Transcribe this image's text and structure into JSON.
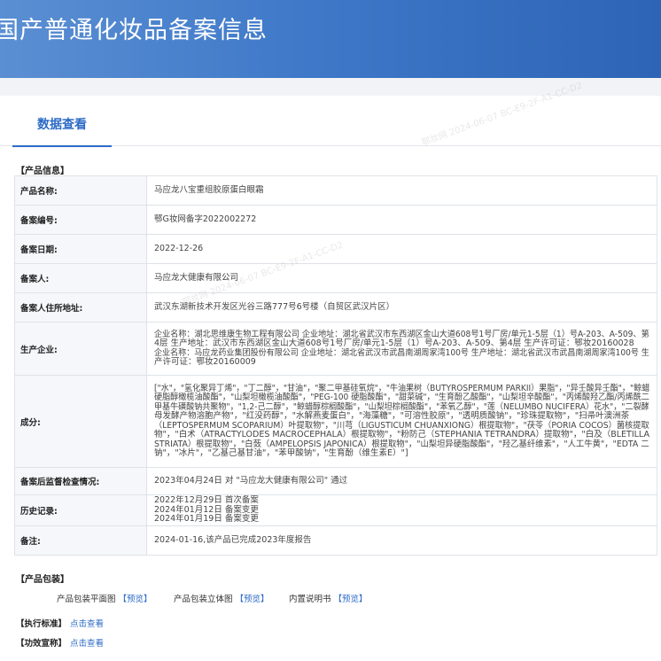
{
  "banner": {
    "title": "国产普通化妆品备案信息"
  },
  "tabs": {
    "active": "数据查看"
  },
  "product_section": {
    "title": "【产品信息】",
    "rows": [
      {
        "label": "产品名称:",
        "value": [
          "马应龙八宝重组胶原蛋白眼霜"
        ]
      },
      {
        "label": "备案编号:",
        "value": [
          "鄂G妆网备字2022002272"
        ]
      },
      {
        "label": "备案日期:",
        "value": [
          "2022-12-26"
        ]
      },
      {
        "label": "备案人:",
        "value": [
          "马应龙大健康有限公司"
        ]
      },
      {
        "label": "备案人住所地址:",
        "value": [
          "武汉东湖新技术开发区光谷三路777号6号楼（自贸区武汉片区）"
        ]
      },
      {
        "label": "生产企业:",
        "value": [
          "企业名称：湖北思维康生物工程有限公司 企业地址：湖北省武汉市东西湖区金山大道608号1号厂房/单元1-5层（1）号A-203、A-509、第",
          "4层 生产地址：武汉市东西湖区金山大道608号1号厂房/单元1-5层（1）号A-203、A-509、第4层 生产许可证：鄂妆20160028",
          "企业名称：马应龙药业集团股份有限公司 企业地址：湖北省武汉市武昌南湖周家湾100号 生产地址：湖北省武汉市武昌南湖周家湾100号 生",
          "产许可证：鄂妆20160009"
        ]
      },
      {
        "label": "成分:",
        "value": [
          "[\"水\"，\"氢化聚异丁烯\"，\"丁二醇\"，\"甘油\"，\"聚二甲基硅氧烷\"，\"牛油果树（BUTYROSPERMUM PARKII）果脂\"，\"异壬酸异壬酯\"，\"鲸蜡",
          "硬脂醇橄榄油酸酯\"，\"山梨坦橄榄油酸酯\"，\"PEG-100 硬脂酸酯\"，\"甜菜碱\"，\"生育酚乙酸酯\"，\"山梨坦辛酸酯\"，\"丙烯酸羟乙酯/丙烯酰二",
          "甲基牛磺酸钠共聚物\"，\"1,2-己二醇\"，\"鲸蜡醇棕榈酸酯\"，\"山梨坦棕榈酸酯\"，\"苯氧乙醇\"，\"莲（NELUMBO NUCIFERA）花水\"，\"二裂酵",
          "母发酵产物溶胞产物\"，\"红没药醇\"，\"水解燕麦蛋白\"，\"海藻糖\"，\"可溶性胶原\"，\"透明质酸钠\"，\"珍珠提取物\"，\"扫帚叶澳洲茶",
          "（LEPTOSPERMUM SCOPARIUM）叶提取物\"，\"川芎（LIGUSTICUM CHUANXIONG）根提取物\"，\"茯苓（PORIA COCOS）菌核提取",
          "物\"，\"白术（ATRACTYLODES MACROCEPHALA）根提取物\"，\"粉防己（STEPHANIA TETRANDRA）提取物\"，\"白及（BLETILLA",
          "STRIATA）根提取物\"，\"白蔹（AMPELOPSIS JAPONICA）根提取物\"，\"山梨坦异硬脂酸酯\"，\"羟乙基纤维素\"，\"人工牛黄\"，\"EDTA 二",
          "钠\"，\"冰片\"，\"乙基己基甘油\"，\"苯甲酸钠\"，\"生育酚（维生素E）\"]"
        ]
      },
      {
        "label": "备案后监督检查情况:",
        "value": [
          "2023年04月24日 对 \"马应龙大健康有限公司\" 通过"
        ]
      },
      {
        "label": "历史记录:",
        "value": [
          "2022年12月29日 首次备案",
          "2024年01月12日 备案变更",
          "2024年01月19日 备案变更"
        ]
      },
      {
        "label": "备注:",
        "value": [
          "2024-01-16,该产品已完成2023年度报告"
        ]
      }
    ]
  },
  "package_section": {
    "title": "【产品包装】",
    "items": [
      {
        "label": "产品包装平面图",
        "link": "【预览】"
      },
      {
        "label": "产品包装立体图",
        "link": "【预览】"
      },
      {
        "label": "内置说明书",
        "link": "【预览】"
      }
    ]
  },
  "standard": {
    "label": "【执行标准】",
    "link": "点击查看"
  },
  "efficacy": {
    "label": "【功效宣称】",
    "link": "点击查看"
  },
  "watermarks": [
    "鄂妆网 2024-06-07 BC-E9-2F-A1-CC-D2",
    "鄂妆网 2024-06-07 BC-E9-2F-A1-CC-D2"
  ]
}
